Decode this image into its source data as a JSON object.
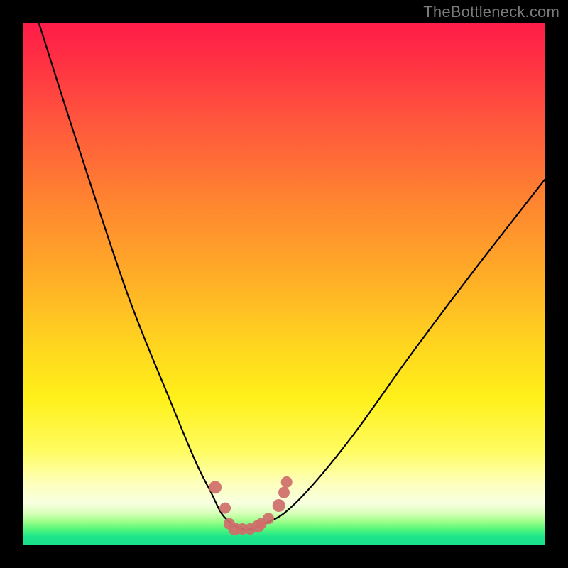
{
  "watermark": "TheBottleneck.com",
  "chart_data": {
    "type": "line",
    "title": "",
    "xlabel": "",
    "ylabel": "",
    "xlim": [
      0,
      100
    ],
    "ylim": [
      0,
      100
    ],
    "grid": false,
    "legend": false,
    "series": [
      {
        "name": "bottleneck-curve",
        "x": [
          3,
          10,
          20,
          28,
          33,
          36,
          38,
          40,
          42,
          44,
          46,
          50,
          56,
          64,
          74,
          86,
          100
        ],
        "y": [
          100,
          78,
          48,
          28,
          16,
          10,
          6,
          4,
          3,
          3,
          4,
          6,
          12,
          22,
          36,
          52,
          70
        ],
        "color": "#000000"
      }
    ],
    "markers": {
      "name": "highlight-dots",
      "color": "#cf6e6b",
      "points_xy": [
        [
          36.8,
          11.0
        ],
        [
          38.7,
          7.0
        ],
        [
          39.5,
          4.0
        ],
        [
          40.5,
          3.0
        ],
        [
          42.0,
          3.0
        ],
        [
          43.5,
          3.0
        ],
        [
          45.0,
          3.5
        ],
        [
          45.6,
          4.0
        ],
        [
          47.0,
          5.0
        ],
        [
          49.0,
          7.5
        ],
        [
          50.0,
          10.0
        ],
        [
          50.5,
          12.0
        ]
      ]
    },
    "gradient_bands": [
      {
        "pos": 0.0,
        "color": "#ff1c49"
      },
      {
        "pos": 0.35,
        "color": "#ff8430"
      },
      {
        "pos": 0.65,
        "color": "#ffd61f"
      },
      {
        "pos": 0.85,
        "color": "#fffc90"
      },
      {
        "pos": 0.95,
        "color": "#a0ff8c"
      },
      {
        "pos": 1.0,
        "color": "#19df8a"
      }
    ]
  }
}
